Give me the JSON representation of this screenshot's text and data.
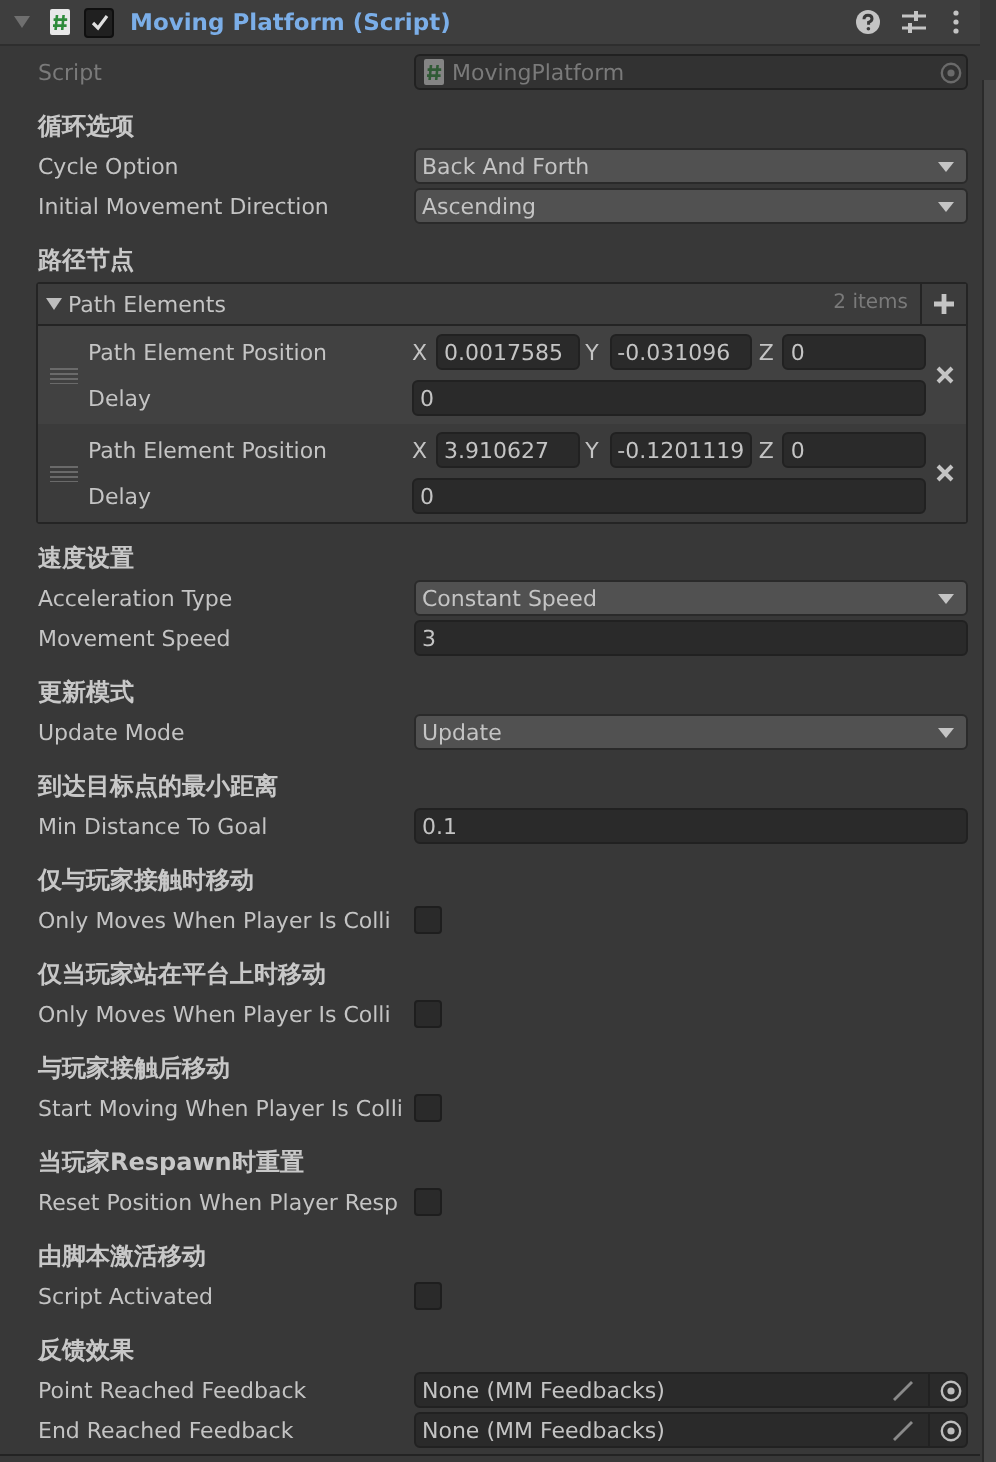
{
  "component": {
    "title": "Moving Platform (Script)",
    "expanded": true,
    "enabled": true
  },
  "script_field": {
    "label": "Script",
    "value": "MovingPlatform"
  },
  "sections": [
    {
      "heading": "循环选项",
      "fields": [
        {
          "kind": "dropdown",
          "label": "Cycle Option",
          "value": "Back And Forth"
        },
        {
          "kind": "dropdown",
          "label": "Initial Movement Direction",
          "value": "Ascending"
        }
      ]
    },
    {
      "heading": "路径节点",
      "fields": [
        {
          "kind": "list",
          "label": "Path Elements",
          "count": "2 items",
          "expanded": true,
          "items": [
            {
              "position_label": "Path Element Position",
              "axes": [
                {
                  "label": "X",
                  "value": "0.0017585"
                },
                {
                  "label": "Y",
                  "value": "-0.031096"
                },
                {
                  "label": "Z",
                  "value": "0"
                }
              ],
              "delay_label": "Delay",
              "delay": "0"
            },
            {
              "position_label": "Path Element Position",
              "axes": [
                {
                  "label": "X",
                  "value": "3.910627"
                },
                {
                  "label": "Y",
                  "value": "-0.1201119"
                },
                {
                  "label": "Z",
                  "value": "0"
                }
              ],
              "delay_label": "Delay",
              "delay": "0"
            }
          ]
        }
      ]
    },
    {
      "heading": "速度设置",
      "fields": [
        {
          "kind": "dropdown",
          "label": "Acceleration Type",
          "value": "Constant Speed"
        },
        {
          "kind": "number",
          "label": "Movement Speed",
          "value": "3"
        }
      ]
    },
    {
      "heading": "更新模式",
      "fields": [
        {
          "kind": "dropdown",
          "label": "Update Mode",
          "value": "Update"
        }
      ]
    },
    {
      "heading": "到达目标点的最小距离",
      "fields": [
        {
          "kind": "number",
          "label": "Min Distance To Goal",
          "value": "0.1"
        }
      ]
    },
    {
      "heading": "仅与玩家接触时移动",
      "fields": [
        {
          "kind": "checkbox",
          "label": "Only Moves When Player Is Colli",
          "checked": false
        }
      ]
    },
    {
      "heading": "仅当玩家站在平台上时移动",
      "fields": [
        {
          "kind": "checkbox",
          "label": "Only Moves When Player Is Colli",
          "checked": false
        }
      ]
    },
    {
      "heading": "与玩家接触后移动",
      "fields": [
        {
          "kind": "checkbox",
          "label": "Start Moving When Player Is Colli",
          "checked": false
        }
      ]
    },
    {
      "heading": "当玩家Respawn时重置",
      "fields": [
        {
          "kind": "checkbox",
          "label": "Reset Position When Player Resp",
          "checked": false
        }
      ]
    },
    {
      "heading": "由脚本激活移动",
      "fields": [
        {
          "kind": "checkbox",
          "label": "Script Activated",
          "checked": false
        }
      ]
    },
    {
      "heading": "反馈效果",
      "fields": [
        {
          "kind": "object",
          "label": "Point Reached Feedback",
          "value": "None (MM Feedbacks)"
        },
        {
          "kind": "object",
          "label": "End Reached Feedback",
          "value": "None (MM Feedbacks)"
        }
      ]
    }
  ]
}
